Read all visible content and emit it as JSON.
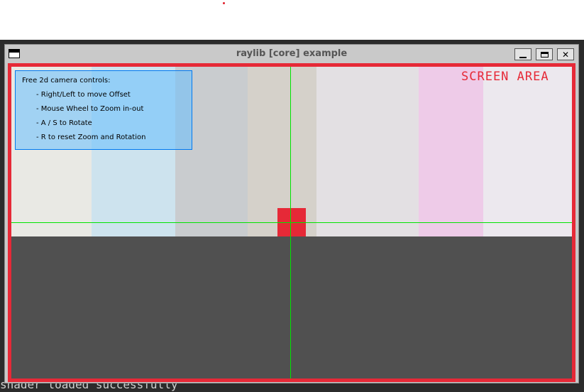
{
  "window": {
    "title": "raylib [core] example",
    "controls": {
      "minimize": "minimize-icon",
      "maximize": "maximize-icon",
      "close": "✕"
    }
  },
  "overlay": {
    "screen_area_label": "SCREEN AREA",
    "help_title": "Free 2d camera controls:",
    "help_lines": [
      "- Right/Left to move Offset",
      "- Mouse Wheel to Zoom in-out",
      "- A / S to Rotate",
      "- R to reset Zoom and Rotation"
    ]
  },
  "background_terminal": {
    "bottom_line": "shader loaded successfully"
  },
  "colors": {
    "accent_red": "#e62937",
    "crosshair_green": "#00e400",
    "help_box_blue": "#66bfff",
    "ground": "#505050"
  }
}
